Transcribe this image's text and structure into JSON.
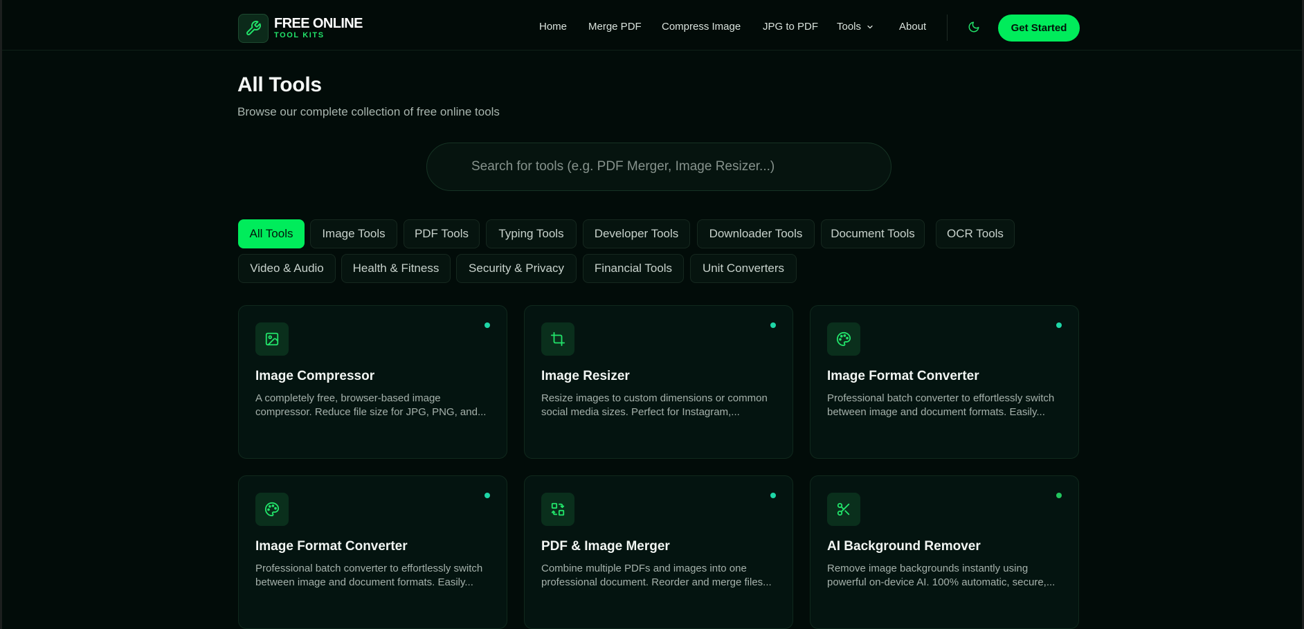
{
  "brand": {
    "name_line1": "FREE ONLINE",
    "name_line2": "TOOL KITS"
  },
  "nav": {
    "links": [
      "Home",
      "Merge PDF",
      "Compress Image",
      "JPG to PDF",
      "Tools",
      "About"
    ],
    "cta_label": "Get Started"
  },
  "page": {
    "title": "All Tools",
    "subtitle": "Browse our complete collection of free online tools"
  },
  "search": {
    "placeholder": "Search for tools (e.g. PDF Merger, Image Resizer...)",
    "value": ""
  },
  "categories": [
    "All Tools",
    "Image Tools",
    "PDF Tools",
    "Typing Tools",
    "Developer Tools",
    "Downloader Tools",
    "Document Tools",
    "OCR Tools",
    "Video & Audio",
    "Health & Fitness",
    "Security & Privacy",
    "Financial Tools",
    "Unit Converters"
  ],
  "active_category": "All Tools",
  "tools": [
    {
      "title": "Image Compressor",
      "description": "A completely free, browser-based image compressor. Reduce file size for JPG, PNG, and...",
      "icon": "image-icon",
      "dot_color": "#1ed6a6"
    },
    {
      "title": "Image Resizer",
      "description": "Resize images to custom dimensions or common social media sizes. Perfect for Instagram,...",
      "icon": "crop-icon",
      "dot_color": "#1ed6a6"
    },
    {
      "title": "Image Format Converter",
      "description": "Professional batch converter to effortlessly switch between image and document formats. Easily...",
      "icon": "palette-icon",
      "dot_color": "#1ed6a6"
    },
    {
      "title": "Image Format Converter",
      "description": "Professional batch converter to effortlessly switch between image and document formats. Easily...",
      "icon": "palette-icon",
      "dot_color": "#1ed6a6"
    },
    {
      "title": "PDF & Image Merger",
      "description": "Combine multiple PDFs and images into one professional document. Reorder and merge files...",
      "icon": "merge-icon",
      "dot_color": "#1ed6a6"
    },
    {
      "title": "AI Background Remover",
      "description": "Remove image backgrounds instantly using powerful on-device AI. 100% automatic, secure,...",
      "icon": "scissors-icon",
      "dot_color": "#22c55e"
    }
  ],
  "colors": {
    "accent": "#00ec5b",
    "background": "#020c09",
    "card": "#041410",
    "icon_green": "#22e36a"
  }
}
